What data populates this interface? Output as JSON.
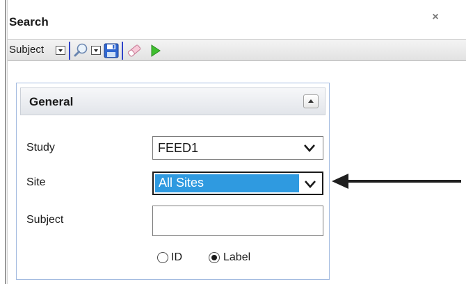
{
  "panel": {
    "title": "Search",
    "close_glyph": "×"
  },
  "toolbar": {
    "subject_label": "Subject",
    "icons": [
      "search-magnifier-icon",
      "save-floppy-icon",
      "eraser-icon",
      "run-play-icon"
    ],
    "accent_color": "#2f43c9"
  },
  "general": {
    "title": "General",
    "study_label": "Study",
    "study_value": "FEED1",
    "site_label": "Site",
    "site_value": "All Sites",
    "subject_label": "Subject",
    "subject_value": "",
    "radio_id_label": "ID",
    "radio_label_label": "Label",
    "selected_radio": "Label"
  },
  "annotation": {
    "arrow_color": "#1f1f1f",
    "highlight_color": "#2f9ae0"
  }
}
